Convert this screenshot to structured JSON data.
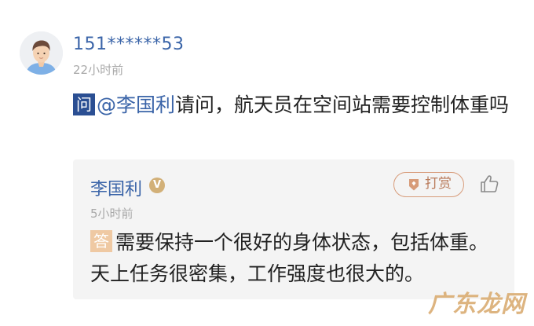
{
  "question_post": {
    "username": "151******53",
    "time": "22小时前",
    "badge": "问",
    "mention": "@李国利",
    "text": "请问，航天员在空间站需要控制体重吗"
  },
  "reply": {
    "author": "李国利",
    "verified_badge": "V",
    "tip_label": "打赏",
    "time": "5小时前",
    "badge": "答",
    "text": "需要保持一个很好的身体状态，包括体重。天上任务很密集，工作强度也很大的。"
  },
  "watermark": "广东龙网",
  "colors": {
    "link_blue": "#3a64a8",
    "question_badge": "#2b4f93",
    "answer_badge": "#efc9a3",
    "tip_border": "#d79b79",
    "card_bg": "#f4f4f4"
  },
  "icons": {
    "avatar": "user-avatar-icon",
    "verified": "verified-v-icon",
    "tip": "diamond-tag-icon",
    "like": "thumbs-up-icon"
  }
}
